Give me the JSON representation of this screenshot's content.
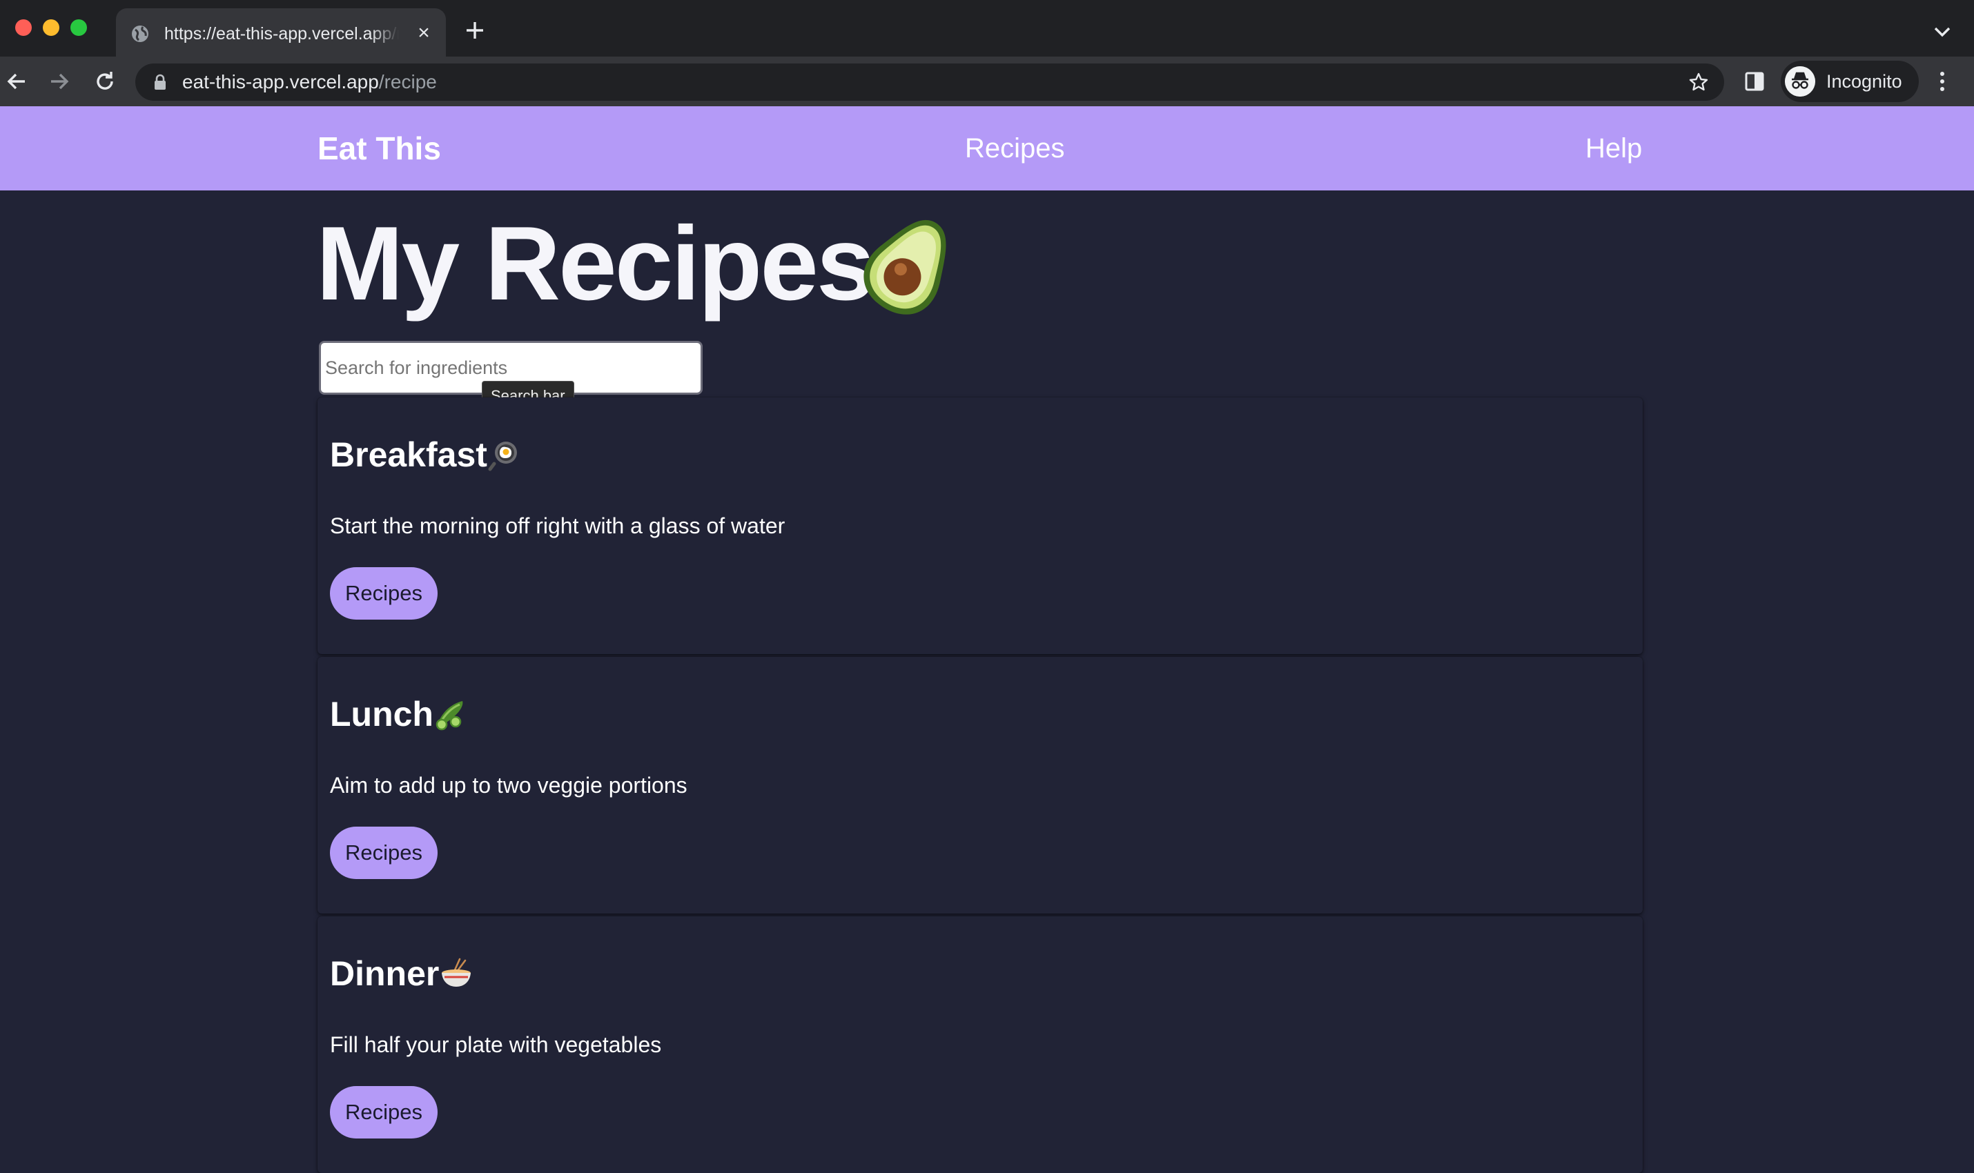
{
  "browser": {
    "tab_title": "https://eat-this-app.vercel.app/recipe",
    "url_host": "eat-this-app.vercel.app",
    "url_path": "/recipe",
    "profile_label": "Incognito"
  },
  "navbar": {
    "brand": "Eat This",
    "links": [
      "Recipes",
      "Help"
    ]
  },
  "page": {
    "title": "My Recipes",
    "search_placeholder": "Search for ingredients",
    "search_value": "",
    "tooltip": "Search bar"
  },
  "cards": [
    {
      "title": "Breakfast",
      "emoji": "fried-egg-in-pan-icon",
      "description": "Start the morning off right with a glass of water",
      "button": "Recipes"
    },
    {
      "title": "Lunch",
      "emoji": "cucumber-icon",
      "description": "Aim to add up to two veggie portions",
      "button": "Recipes"
    },
    {
      "title": "Dinner",
      "emoji": "noodle-bowl-icon",
      "description": "Fill half your plate with vegetables",
      "button": "Recipes"
    }
  ],
  "colors": {
    "accent": "#b49af7",
    "background": "#212336",
    "chrome_dark": "#202124",
    "chrome_toolbar": "#35363a"
  }
}
